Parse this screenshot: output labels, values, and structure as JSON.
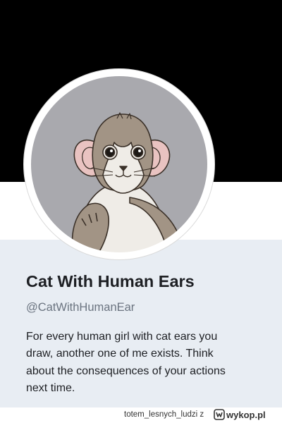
{
  "profile": {
    "display_name": "Cat With Human Ears",
    "handle": "@CatWithHumanEar",
    "bio_lines": [
      "For every human girl with cat ears you",
      "draw, another one of me exists. Think",
      "about the consequences of your actions",
      "next time."
    ]
  },
  "watermark": {
    "uploader": "totem_lesnych_ludzi z",
    "site": "wykop.pl"
  },
  "icons": {
    "avatar": "cat-with-human-ears-illustration",
    "site_logo": "wykop-logo-icon"
  },
  "colors": {
    "banner": "#000000",
    "card_background": "#e8edf3",
    "name_text": "#1d1f23",
    "handle_text": "#6b7480",
    "avatar_background": "#a9a9ae"
  }
}
